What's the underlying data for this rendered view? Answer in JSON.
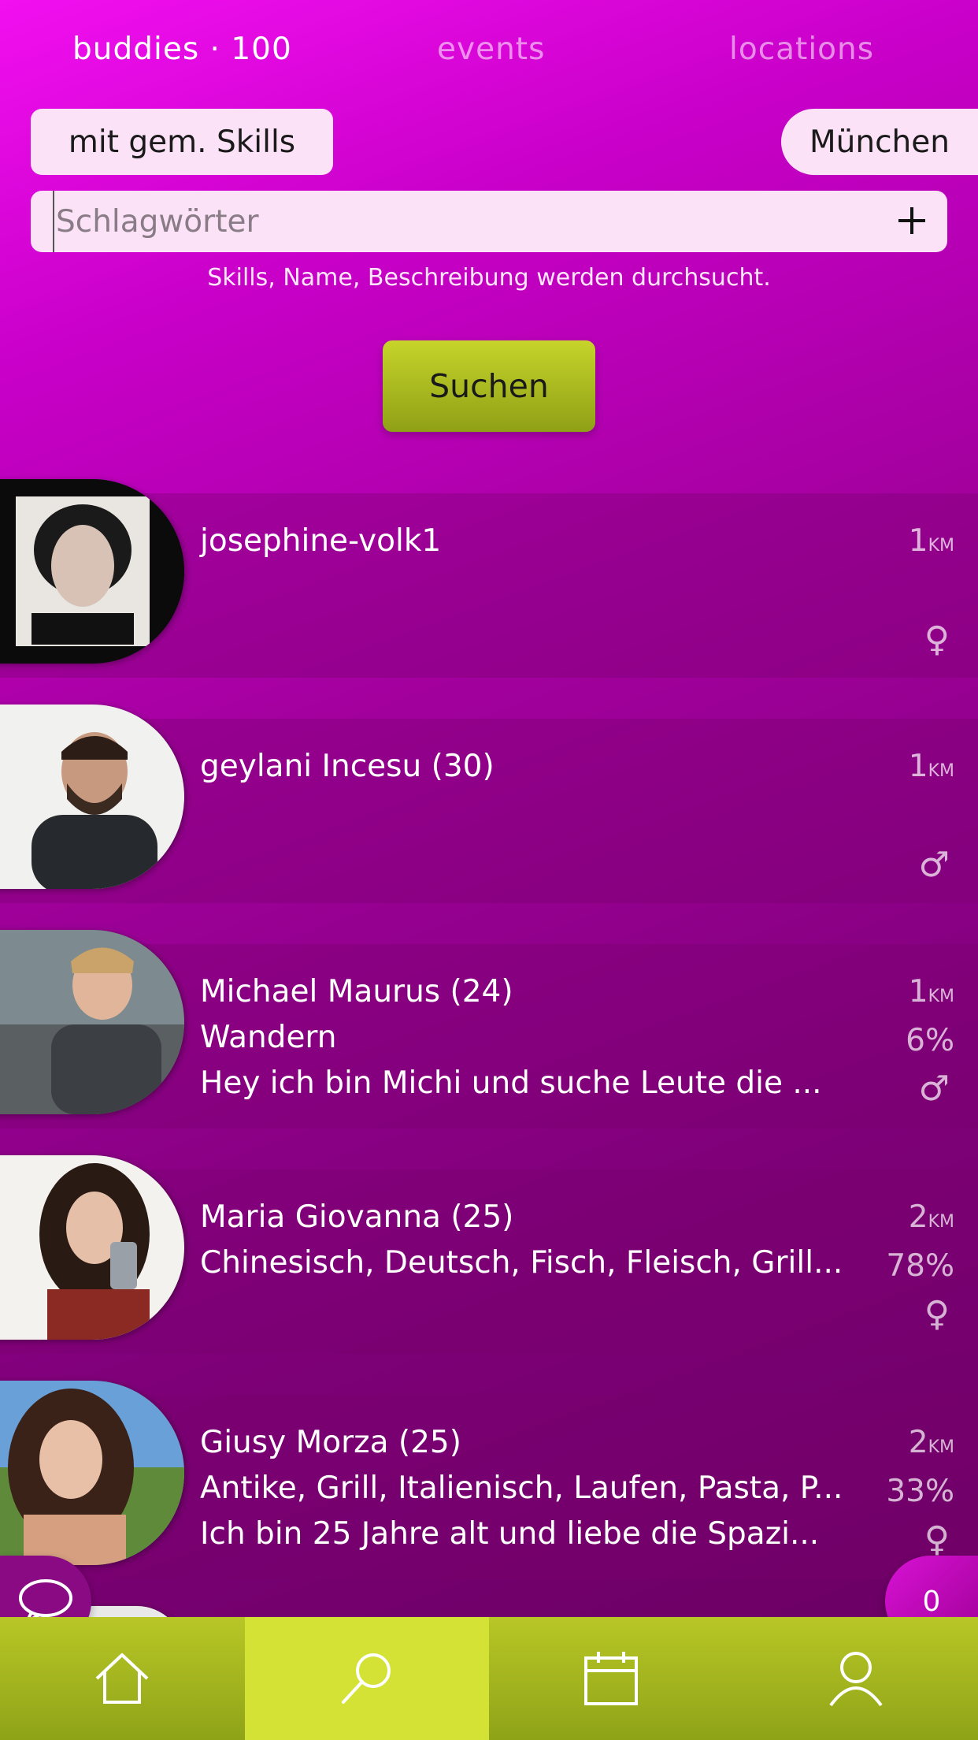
{
  "tabs": [
    {
      "label": "buddies · 100",
      "active": true
    },
    {
      "label": "events",
      "active": false
    },
    {
      "label": "locations",
      "active": false
    }
  ],
  "filters": {
    "skills_chip": "mit gem. Skills",
    "location_chip": "München"
  },
  "search": {
    "placeholder": "Schlagwörter",
    "hint": "Skills, Name, Beschreibung werden durchsucht.",
    "button_label": "Suchen"
  },
  "buddies": [
    {
      "name": "josephine-volk1",
      "line1": "",
      "line2": "",
      "distance": "1",
      "unit": "KM",
      "match": "",
      "gender": "♀"
    },
    {
      "name": "geylani Incesu (30)",
      "line1": "",
      "line2": "",
      "distance": "1",
      "unit": "KM",
      "match": "",
      "gender": "♂"
    },
    {
      "name": "Michael Maurus (24)",
      "line1": "Wandern",
      "line2": "Hey ich bin Michi und suche Leute die ...",
      "distance": "1",
      "unit": "KM",
      "match": "6%",
      "gender": "♂"
    },
    {
      "name": "Maria Giovanna (25)",
      "line1": "Chinesisch, Deutsch, Fisch, Fleisch, Grill...",
      "line2": "",
      "distance": "2",
      "unit": "KM",
      "match": "78%",
      "gender": "♀"
    },
    {
      "name": "Giusy Morza (25)",
      "line1": "Antike, Grill, Italienisch, Laufen, Pasta, P...",
      "line2": "Ich bin 25 Jahre alt und liebe die Spazi...",
      "distance": "2",
      "unit": "KM",
      "match": "33%",
      "gender": "♀"
    }
  ],
  "notifications": {
    "count": "0"
  },
  "nav": [
    {
      "icon": "home-icon"
    },
    {
      "icon": "search-icon",
      "active": true
    },
    {
      "icon": "calendar-icon"
    },
    {
      "icon": "profile-icon"
    }
  ],
  "colors": {
    "accent_green": "#c6d42a",
    "magenta": "#f20ff0",
    "chip_bg": "#fbe2f7"
  }
}
